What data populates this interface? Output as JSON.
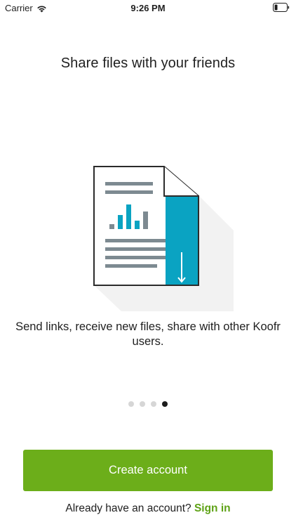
{
  "status_bar": {
    "carrier": "Carrier",
    "time": "9:26 PM",
    "wifi_icon": "wifi-icon",
    "battery_icon": "battery-icon"
  },
  "onboarding": {
    "title": "Share files with your friends",
    "description": "Send links, receive new files, share with other Koofr users.",
    "illustration_icon": "shared-document-icon",
    "page_count": 4,
    "active_page": 4
  },
  "actions": {
    "create_account_label": "Create account",
    "signin_prompt": "Already have an account?",
    "signin_label": "Sign in"
  },
  "colors": {
    "primary_green": "#6cae1a",
    "link_green": "#5ea216",
    "accent_blue": "#0aa3c2",
    "dot_inactive": "#d6d6d6",
    "dot_active": "#1c1c1c"
  }
}
